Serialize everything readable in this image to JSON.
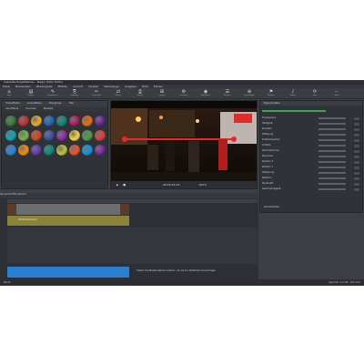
{
  "window": {
    "title": "Cassette-ProjektName – Magix Video Editor"
  },
  "menu": [
    "Datei",
    "Bearbeiten",
    "Wiedergabe",
    "Effekte",
    "Ansicht",
    "Fenster",
    "Werkzeuge",
    "Ausgabe",
    "Hilfe",
    "Extras"
  ],
  "toolbar": [
    {
      "icon": "⌂",
      "label": "Start"
    },
    {
      "icon": "▤",
      "label": "Projekt"
    },
    {
      "icon": "✎",
      "label": "Bearbeiten"
    },
    {
      "icon": "⎘",
      "label": "Kopieren"
    },
    {
      "icon": "✂",
      "label": "Schneiden"
    },
    {
      "icon": "⇄",
      "label": "Effekte"
    },
    {
      "icon": "⎙",
      "label": "Export"
    },
    {
      "icon": "⊞",
      "label": "Layout"
    },
    {
      "icon": "⚙",
      "label": "Optionen"
    },
    {
      "icon": "◉",
      "label": "Aufnahme"
    },
    {
      "icon": "☰",
      "label": "Medien"
    },
    {
      "icon": "⊕",
      "label": "Hinzufügen"
    },
    {
      "icon": "⚑",
      "label": "Marker"
    },
    {
      "icon": "♪",
      "label": "Audio"
    },
    {
      "icon": "⟳",
      "label": "Sync"
    },
    {
      "icon": "⋯",
      "label": "Mehr"
    }
  ],
  "effects_panel": {
    "tabs": [
      "Videoeffekte",
      "Audioeffekte",
      "Übergänge",
      "Titel"
    ],
    "subtabs": [
      "Alle Effekte",
      "Favoriten",
      "Beliebte"
    ],
    "colors": [
      "#2e7d32",
      "#c62828",
      "#f9a825",
      "#1565c0",
      "#00897b",
      "#ad1457",
      "#ef6c00",
      "#6a1b9a",
      "#00acc1",
      "#7cb342",
      "#d84315",
      "#3949ab",
      "#8e24aa",
      "#fdd835",
      "#43a047",
      "#e53935",
      "#1e88e5",
      "#fb8c00",
      "#5e35b1",
      "#00897b",
      "#c0ca33",
      "#f4511e",
      "#039be5",
      "#7b1fa2"
    ]
  },
  "preview": {
    "timecode": "00:00:16:14",
    "zoom": "100%"
  },
  "properties": {
    "header": "Eigenschaften",
    "rows": [
      {
        "label": "Transparenz"
      },
      {
        "label": "Helligkeit"
      },
      {
        "label": "Kontrast"
      },
      {
        "label": "Sättigung"
      },
      {
        "label": "Farbtemperatur"
      },
      {
        "label": "Schärfe"
      },
      {
        "label": "Weichzeichnen"
      },
      {
        "label": "Rauschen"
      },
      {
        "label": "Position X"
      },
      {
        "label": "Position Y"
      },
      {
        "label": "Skalierung"
      },
      {
        "label": "Rotation"
      },
      {
        "label": "Deckkraft"
      },
      {
        "label": "Geschwindigkeit"
      }
    ],
    "footer_button": "Zurücksetzen"
  },
  "timeline": {
    "tabs": [
      "Spuransicht",
      "Storyboard"
    ],
    "clip_label": "Street Musicians",
    "audio_label": "Audio (Stereo)",
    "hint": "Ziehen Sie Mediendateien hierher, um sie zur Zeitleiste hinzuzufügen"
  },
  "status": {
    "left": "Bereit",
    "right": "Speicher: 2,1 GB · CPU 12%"
  }
}
